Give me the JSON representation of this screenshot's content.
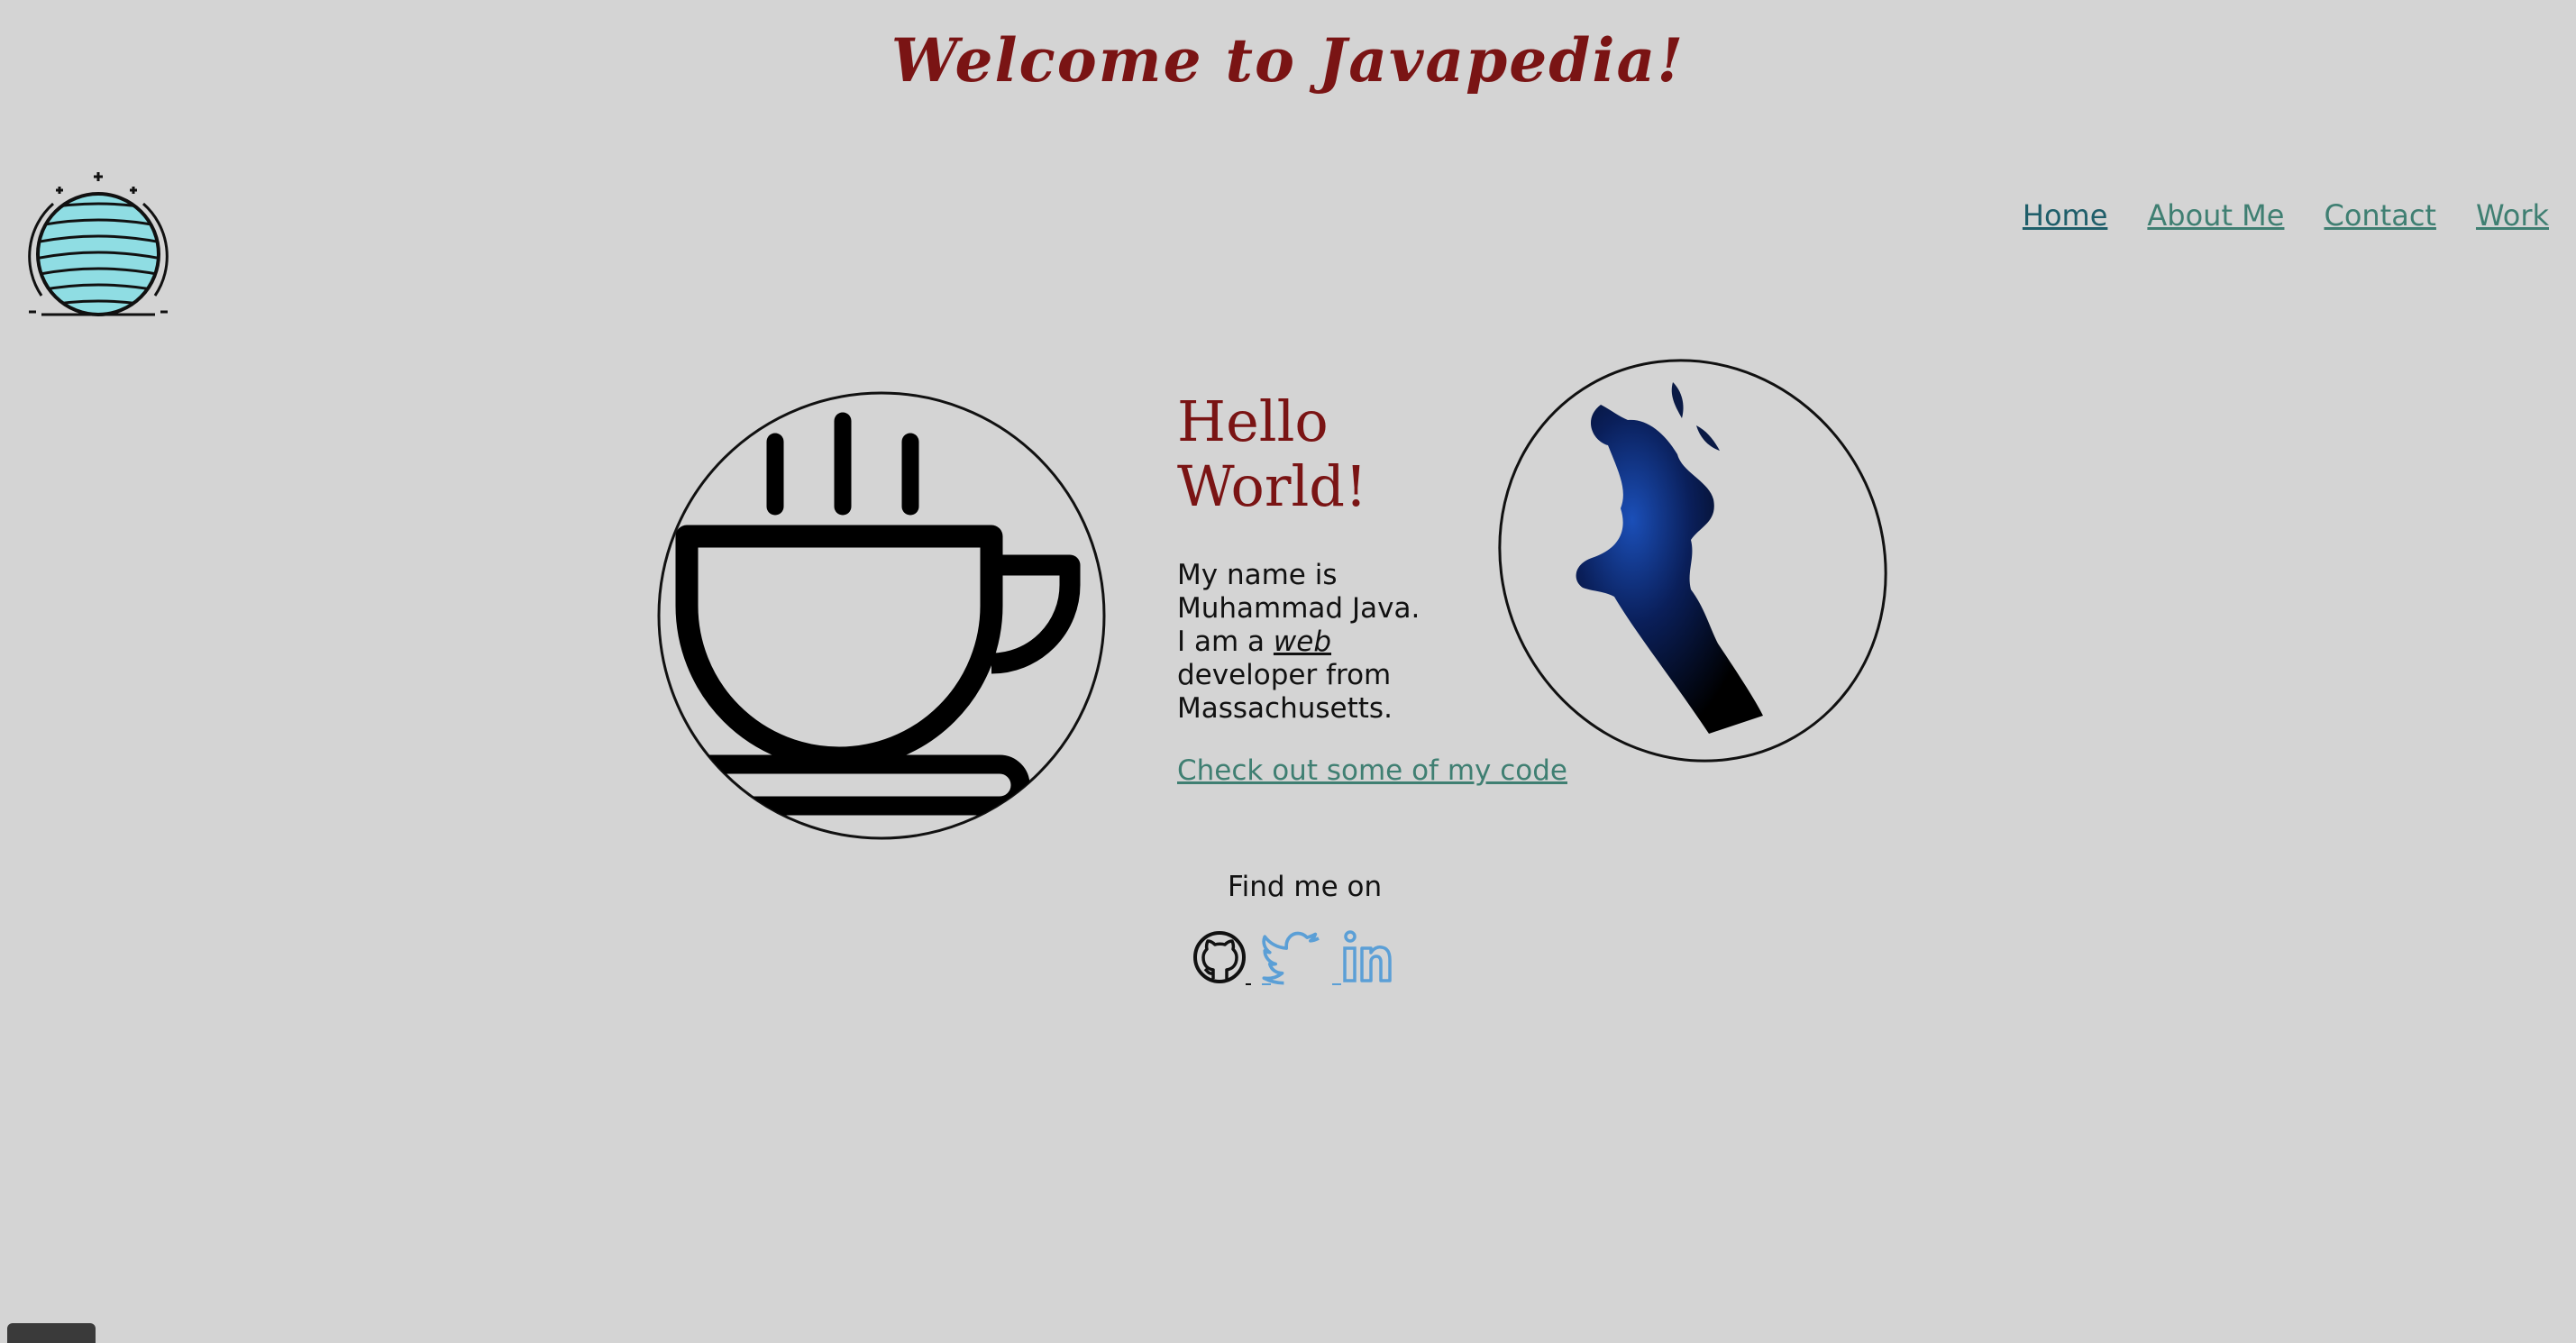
{
  "header": {
    "title": "Welcome to Javapedia!"
  },
  "nav": {
    "items": [
      {
        "label": "Home"
      },
      {
        "label": "About Me"
      },
      {
        "label": "Contact"
      },
      {
        "label": "Work"
      }
    ],
    "active_color": "#1f5e6a",
    "link_color": "#3f7f72"
  },
  "hero": {
    "title_line1": "Hello",
    "title_line2": "World!",
    "bio_line1": "My name is",
    "bio_line2": "Muhammad Java.",
    "bio_line3_pre": "I am a ",
    "bio_web": "web",
    "bio_line4": "developer from",
    "bio_line5": "Massachusetts.",
    "code_link": "Check out some of my code"
  },
  "social": {
    "heading": "Find me on",
    "icons": [
      "github-icon",
      "twitter-icon",
      "linkedin-icon"
    ]
  },
  "colors": {
    "background": "#d4d4d4",
    "title": "#7a1414",
    "globe": "#8fdde3",
    "twitter": "#5b9fd6"
  }
}
